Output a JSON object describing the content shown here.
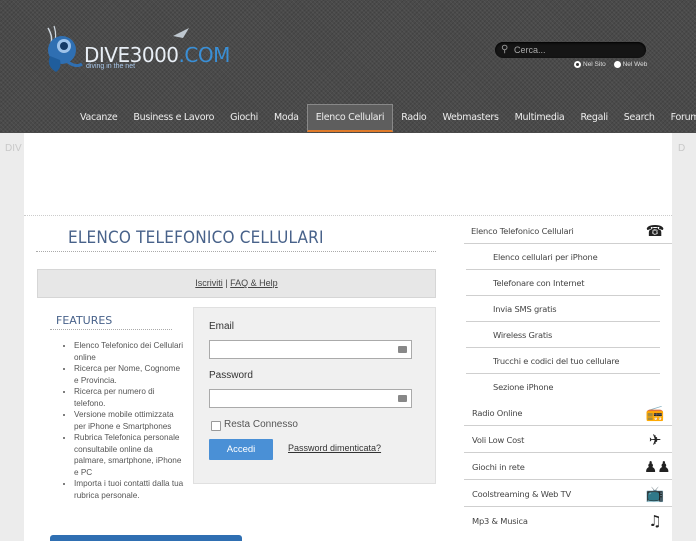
{
  "header": {
    "logo_text": "DIVE3000",
    "logo_suffix": ".COM",
    "tagline": "diving in the net",
    "search_placeholder": "Cerca...",
    "search_scope": [
      {
        "label": "Nel Sito",
        "selected": true
      },
      {
        "label": "Nel Web",
        "selected": false
      }
    ]
  },
  "nav": {
    "items": [
      {
        "label": "Vacanze"
      },
      {
        "label": "Business e Lavoro"
      },
      {
        "label": "Giochi"
      },
      {
        "label": "Moda"
      },
      {
        "label": "Elenco Cellulari",
        "active": true
      },
      {
        "label": "Radio"
      },
      {
        "label": "Webmasters"
      },
      {
        "label": "Multimedia"
      },
      {
        "label": "Regali"
      },
      {
        "label": "Search"
      },
      {
        "label": "Forum"
      }
    ]
  },
  "edges": {
    "left": "DIV",
    "right": "D"
  },
  "main": {
    "title": "ELENCO TELEFONICO CELLULARI",
    "links": {
      "iscriviti": "Iscriviti",
      "separator": "|",
      "faq": "FAQ & Help"
    },
    "features": {
      "title": "FEATURES",
      "items": [
        "Elenco Telefonico dei Cellulari online",
        "Ricerca per Nome, Cognome e Provincia.",
        "Ricerca per numero di telefono.",
        "Versione mobile ottimizzata per iPhone e Smartphones",
        "Rubrica Telefonica personale consultabile online da palmare, smartphone, iPhone e PC",
        "Importa i tuoi contatti dalla tua rubrica personale."
      ]
    },
    "login": {
      "email_label": "Email",
      "email_value": "",
      "password_label": "Password",
      "password_value": "",
      "remember_label": "Resta Connesso",
      "remember_checked": false,
      "submit_label": "Accedi",
      "forgot_label": "Password dimenticata?"
    }
  },
  "sidebar": {
    "top": {
      "label": "Elenco Telefonico Cellulari",
      "icon": "telephone-icon"
    },
    "sub_items": [
      "Elenco cellulari per iPhone",
      "Telefonare con Internet",
      "Invia SMS gratis",
      "Wireless Gratis",
      "Trucchi e codici del tuo cellulare",
      "Sezione iPhone"
    ],
    "main_items": [
      {
        "label": "Radio Online",
        "icon": "radio-icon"
      },
      {
        "label": "Voli Low Cost",
        "icon": "paper-plane-icon"
      },
      {
        "label": "Giochi in rete",
        "icon": "game-icon"
      },
      {
        "label": "Coolstreaming & Web TV",
        "icon": "tv-icon"
      },
      {
        "label": "Mp3 & Musica",
        "icon": "music-icon"
      }
    ]
  },
  "colors": {
    "accent": "#48628a",
    "button": "#4a90d6",
    "nav_active_border": "#e07b2a"
  }
}
